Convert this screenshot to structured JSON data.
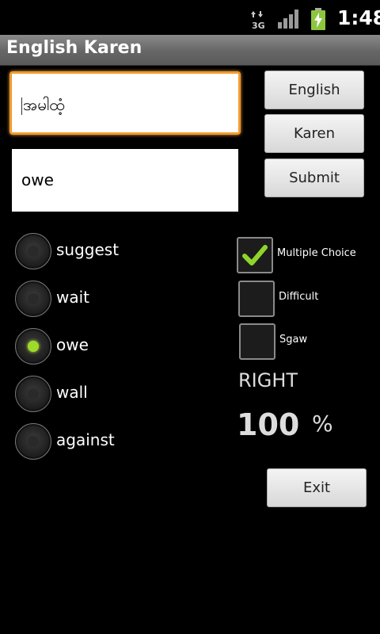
{
  "status_bar": {
    "network": "3G",
    "time": "1:48"
  },
  "app": {
    "title": "English Karen"
  },
  "fields": {
    "karen_value": "အမါထံ့",
    "english_value": "owe"
  },
  "buttons": {
    "english": "English",
    "karen": "Karen",
    "submit": "Submit",
    "exit": "Exit"
  },
  "choices": [
    {
      "label": "suggest",
      "selected": false
    },
    {
      "label": "wait",
      "selected": false
    },
    {
      "label": "owe",
      "selected": true
    },
    {
      "label": "wall",
      "selected": false
    },
    {
      "label": "against",
      "selected": false
    }
  ],
  "options": [
    {
      "label": "Multiple Choice",
      "checked": true
    },
    {
      "label": "Difficult",
      "checked": false
    },
    {
      "label": "Sgaw",
      "checked": false
    }
  ],
  "result": {
    "label": "RIGHT",
    "score": "100",
    "unit": "%"
  },
  "colors": {
    "focus": "#f29a2e",
    "radio_selected": "#9edb2a",
    "check": "#8fd42a"
  }
}
